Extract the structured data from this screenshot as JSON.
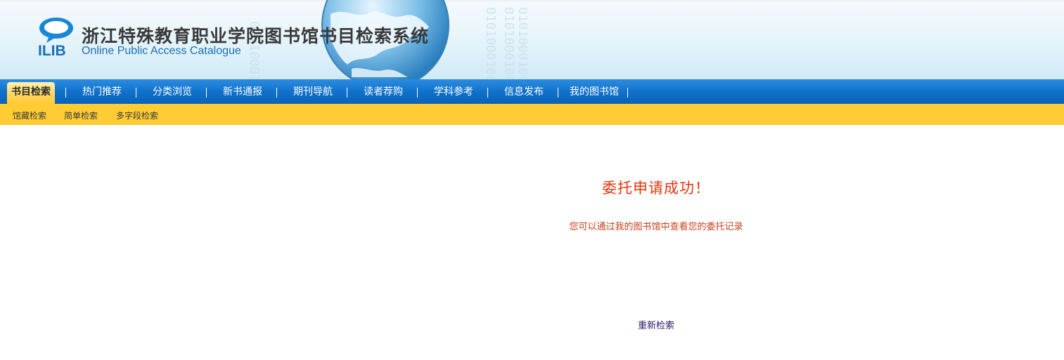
{
  "header": {
    "title": "浙江特殊教育职业学院图书馆书目检索系统",
    "subtitle": "Online Public Access Catalogue",
    "logo_text": "ILIB",
    "decor_digits": "0101000100101"
  },
  "mainnav": {
    "items": [
      {
        "label": "书目检索",
        "active": true
      },
      {
        "label": "热门推荐"
      },
      {
        "label": "分类浏览"
      },
      {
        "label": "新书通报"
      },
      {
        "label": "期刊导航"
      },
      {
        "label": "读者荐购"
      },
      {
        "label": "学科参考"
      },
      {
        "label": "信息发布"
      },
      {
        "label": "我的图书馆"
      }
    ]
  },
  "subnav": {
    "items": [
      {
        "label": "馆藏检索"
      },
      {
        "label": "简单检索"
      },
      {
        "label": "多字段检索"
      }
    ]
  },
  "content": {
    "success_title": "委托申请成功！",
    "success_message": "您可以通过我的图书馆中查看您的委托记录",
    "research_link": "重新检索"
  },
  "colors": {
    "nav_blue": "#0f6fc9",
    "subnav_yellow": "#ffcc33",
    "success_red": "#e8330c",
    "link_purple": "#2b1a66",
    "subtitle_blue": "#1a6fb5"
  }
}
